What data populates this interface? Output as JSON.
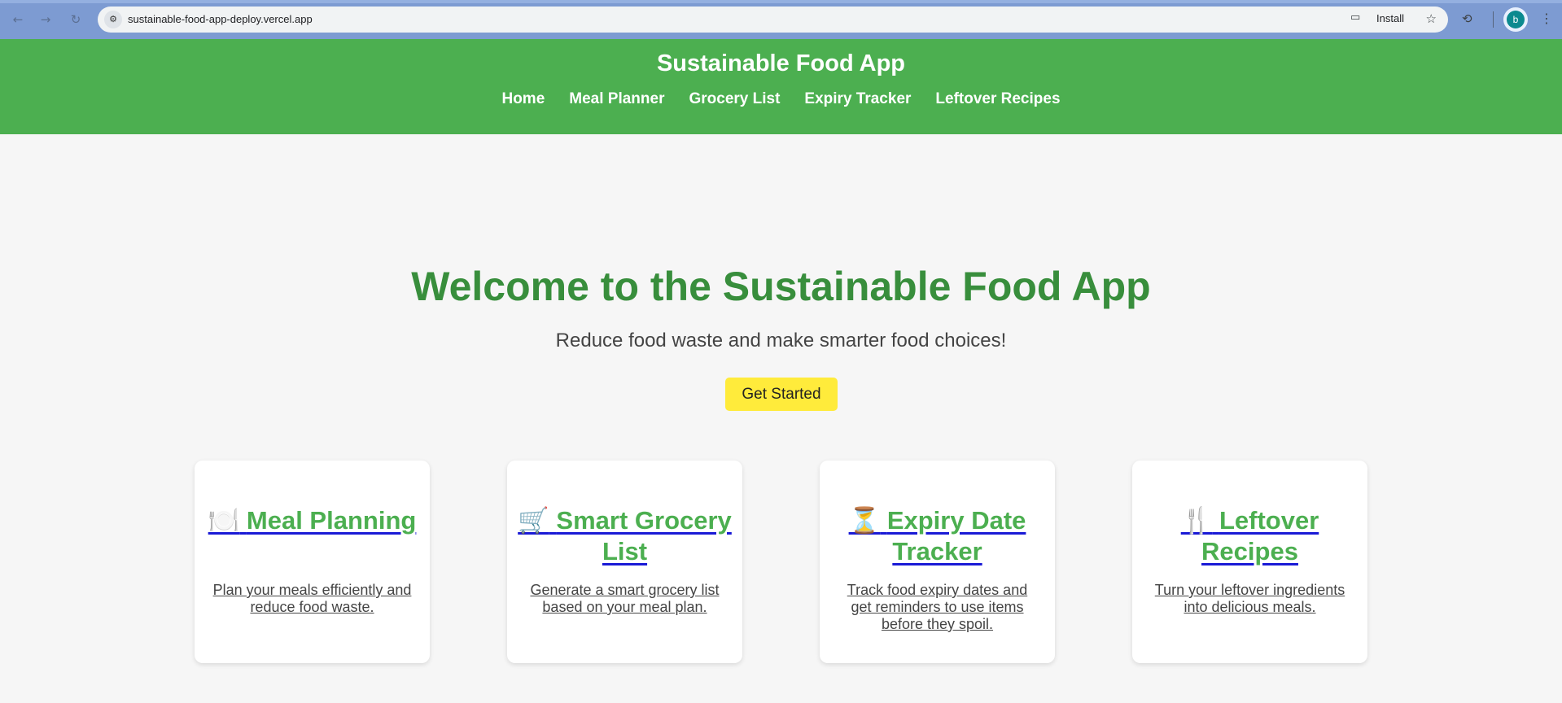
{
  "browser": {
    "url": "sustainable-food-app-deploy.vercel.app",
    "install_label": "Install",
    "avatar_letter": "b"
  },
  "header": {
    "title": "Sustainable Food App",
    "nav": [
      "Home",
      "Meal Planner",
      "Grocery List",
      "Expiry Tracker",
      "Leftover Recipes"
    ]
  },
  "hero": {
    "title": "Welcome to the Sustainable Food App",
    "subtitle": "Reduce food waste and make smarter food choices!",
    "cta_label": "Get Started"
  },
  "cards": [
    {
      "icon": "🍽️",
      "icon_name": "plate-icon",
      "title": "Meal Planning",
      "desc": "Plan your meals efficiently and reduce food waste."
    },
    {
      "icon": "🛒",
      "icon_name": "cart-icon",
      "title": "Smart Grocery List",
      "desc": "Generate a smart grocery list based on your meal plan."
    },
    {
      "icon": "⏳",
      "icon_name": "hourglass-icon",
      "title": "Expiry Date Tracker",
      "desc": "Track food expiry dates and get reminders to use items before they spoil."
    },
    {
      "icon": "🍴",
      "icon_name": "fork-knife-icon",
      "title": "Leftover Recipes",
      "desc": "Turn your leftover ingredients into delicious meals."
    }
  ],
  "colors": {
    "header_green": "#4caf50",
    "hero_green": "#388e3c",
    "cta_yellow": "#ffeb3b"
  }
}
